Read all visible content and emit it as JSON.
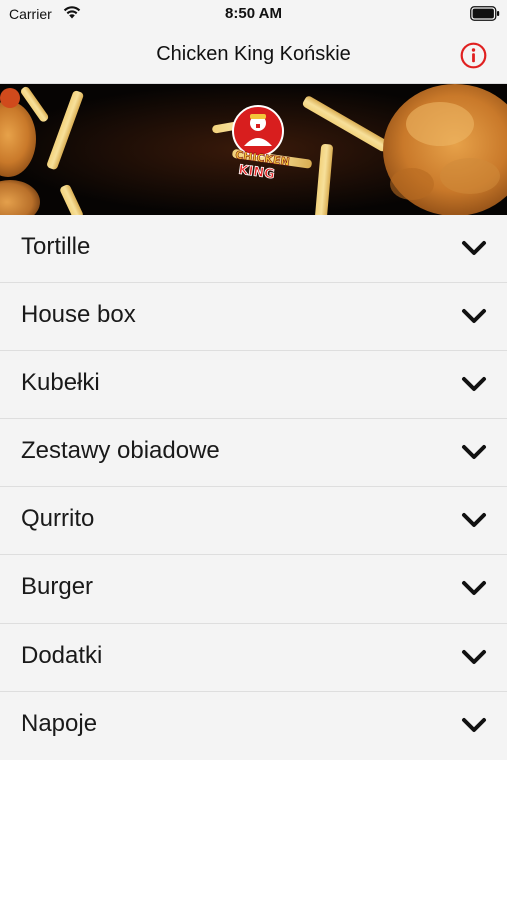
{
  "status_bar": {
    "carrier": "Carrier",
    "time": "8:50 AM",
    "wifi_icon": "wifi-icon",
    "battery_icon": "battery-icon"
  },
  "nav": {
    "title": "Chicken King Końskie",
    "info_icon": "info-icon",
    "accent_color": "#e02020"
  },
  "banner": {
    "logo_text_top": "CHICKEN",
    "logo_text_bottom": "KING",
    "logo_color": "#d81e1e"
  },
  "menu": {
    "items": [
      {
        "label": "Tortille"
      },
      {
        "label": "House box"
      },
      {
        "label": "Kubełki"
      },
      {
        "label": "Zestawy obiadowe"
      },
      {
        "label": "Qurrito"
      },
      {
        "label": "Burger"
      },
      {
        "label": "Dodatki"
      },
      {
        "label": "Napoje"
      }
    ],
    "chevron_icon": "chevron-down-icon"
  }
}
